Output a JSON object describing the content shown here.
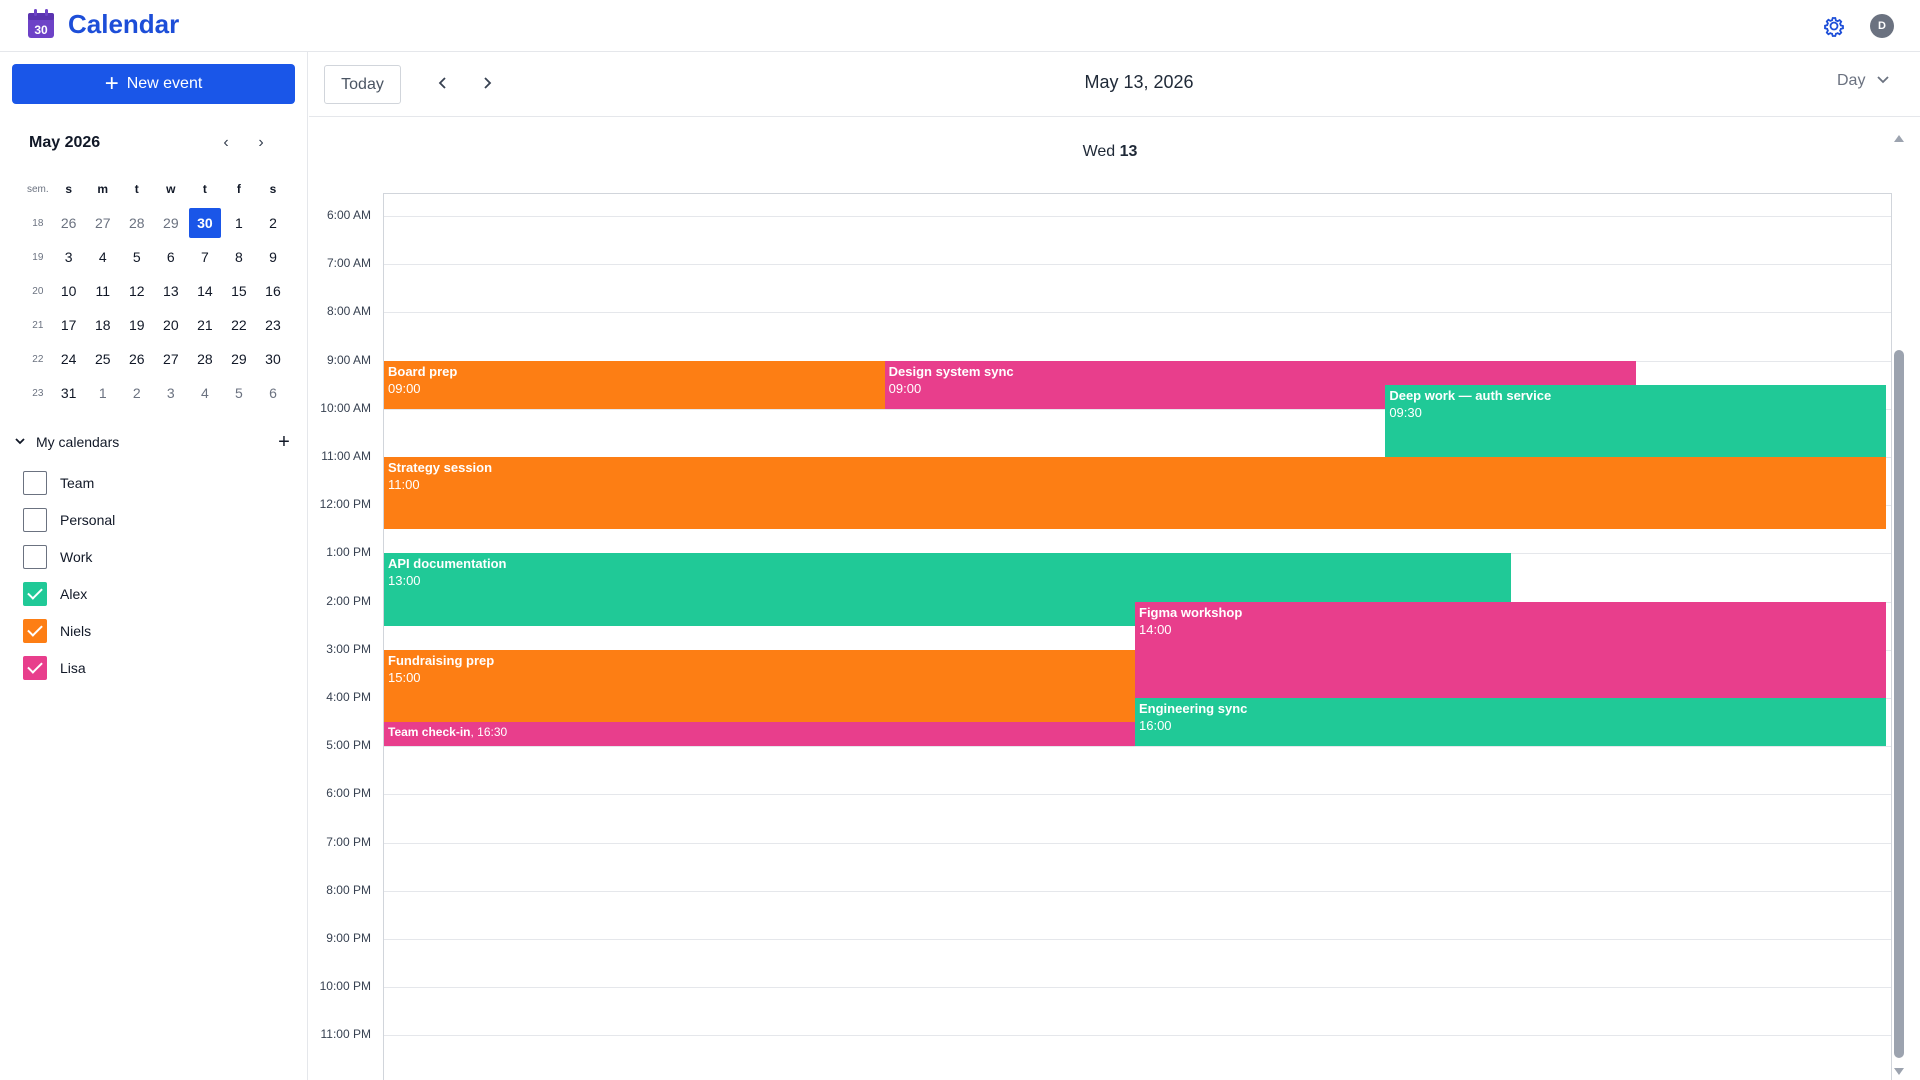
{
  "app": {
    "title": "Calendar",
    "logo_day": "30",
    "avatar_initial": "D"
  },
  "sidebar": {
    "new_event_label": "New event",
    "mini_cal": {
      "title": "May 2026",
      "week_header": "sem.",
      "weekdays": [
        "s",
        "m",
        "t",
        "w",
        "t",
        "f",
        "s"
      ],
      "weeks": [
        {
          "wk": "18",
          "days": [
            "26",
            "27",
            "28",
            "29",
            "30",
            "1",
            "2"
          ]
        },
        {
          "wk": "19",
          "days": [
            "3",
            "4",
            "5",
            "6",
            "7",
            "8",
            "9"
          ]
        },
        {
          "wk": "20",
          "days": [
            "10",
            "11",
            "12",
            "13",
            "14",
            "15",
            "16"
          ]
        },
        {
          "wk": "21",
          "days": [
            "17",
            "18",
            "19",
            "20",
            "21",
            "22",
            "23"
          ]
        },
        {
          "wk": "22",
          "days": [
            "24",
            "25",
            "26",
            "27",
            "28",
            "29",
            "30"
          ]
        },
        {
          "wk": "23",
          "days": [
            "31",
            "1",
            "2",
            "3",
            "4",
            "5",
            "6"
          ]
        }
      ],
      "selected": {
        "week": 0,
        "day": 4
      }
    },
    "calendars_label": "My calendars",
    "calendars": [
      {
        "name": "Team",
        "checked": false,
        "color": "#ffffff"
      },
      {
        "name": "Personal",
        "checked": false,
        "color": "#ffffff"
      },
      {
        "name": "Work",
        "checked": false,
        "color": "#ffffff"
      },
      {
        "name": "Alex",
        "checked": true,
        "color": "#20c997"
      },
      {
        "name": "Niels",
        "checked": true,
        "color": "#fd7e14"
      },
      {
        "name": "Lisa",
        "checked": true,
        "color": "#e83e8c"
      }
    ]
  },
  "header": {
    "today_label": "Today",
    "date_title": "May 13, 2026",
    "view_label": "Day"
  },
  "day": {
    "weekday": "Wed",
    "date_num": "13",
    "hours": [
      "6:00 AM",
      "7:00 AM",
      "8:00 AM",
      "9:00 AM",
      "10:00 AM",
      "11:00 AM",
      "12:00 PM",
      "1:00 PM",
      "2:00 PM",
      "3:00 PM",
      "4:00 PM",
      "5:00 PM",
      "6:00 PM",
      "7:00 PM",
      "8:00 PM",
      "9:00 PM",
      "10:00 PM",
      "11:00 PM"
    ]
  },
  "colors": {
    "orange": "#fd7e14",
    "pink": "#e83e8c",
    "green": "#20c997",
    "accent": "#1a56e8"
  },
  "events": [
    {
      "title": "Board prep",
      "start": "09:00",
      "start_h": 9.0,
      "end_h": 10.0,
      "col": 0,
      "span": 1,
      "cols": 3,
      "color": "#fd7e14"
    },
    {
      "title": "Design system sync",
      "start": "09:00",
      "start_h": 9.0,
      "end_h": 10.0,
      "col": 1,
      "span": 1.5,
      "cols": 3,
      "color": "#e83e8c"
    },
    {
      "title": "Deep work — auth service",
      "start": "09:30",
      "start_h": 9.5,
      "end_h": 11.0,
      "col": 2,
      "span": 1,
      "cols": 3,
      "color": "#20c997"
    },
    {
      "title": "Strategy session",
      "start": "11:00",
      "start_h": 11.0,
      "end_h": 12.5,
      "col": 0,
      "span": 1,
      "cols": 1,
      "color": "#fd7e14"
    },
    {
      "title": "API documentation",
      "start": "13:00",
      "start_h": 13.0,
      "end_h": 14.5,
      "col": 0,
      "span": 1.5,
      "cols": 2,
      "color": "#20c997"
    },
    {
      "title": "Figma workshop",
      "start": "14:00",
      "start_h": 14.0,
      "end_h": 16.0,
      "col": 1,
      "span": 1,
      "cols": 2,
      "color": "#e83e8c"
    },
    {
      "title": "Fundraising prep",
      "start": "15:00",
      "start_h": 15.0,
      "end_h": 16.5,
      "col": 0,
      "span": 1,
      "cols": 2,
      "color": "#fd7e14"
    },
    {
      "title": "Engineering sync",
      "start": "16:00",
      "start_h": 16.0,
      "end_h": 17.0,
      "col": 1,
      "span": 1,
      "cols": 2,
      "color": "#20c997"
    },
    {
      "title": "Team check-in",
      "start": ", 16:30",
      "start_h": 16.5,
      "end_h": 17.0,
      "col": 0,
      "span": 1,
      "cols": 2,
      "color": "#e83e8c",
      "inline": true
    }
  ]
}
